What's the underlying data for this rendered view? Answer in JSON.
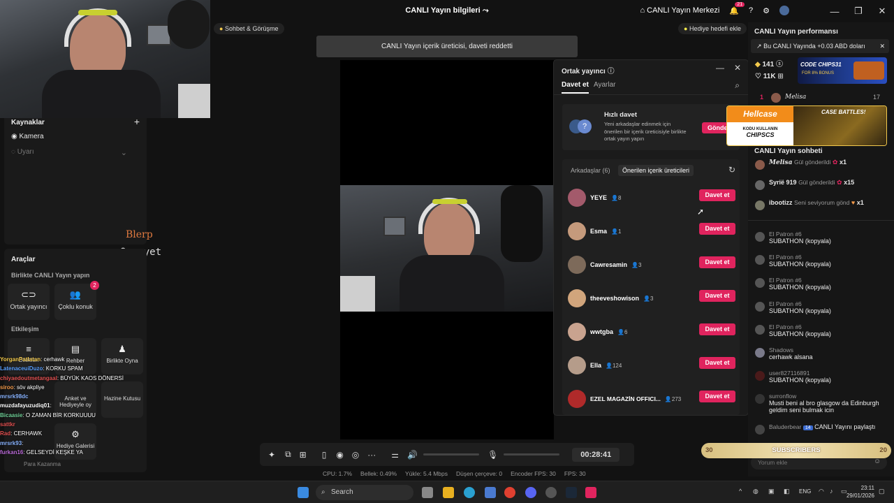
{
  "titlebar": {
    "title": "CANLI Yayın bilgileri",
    "live_center": "CANLI Yayın Merkezi",
    "notif_count": "21"
  },
  "left": {
    "sources_title": "Kaynaklar",
    "camera_label": "Kamera",
    "alerts_label": "Uyarı",
    "overlay_blerp": "Blerp",
    "overlay_overyet": "Overyet",
    "tools_title": "Araçlar",
    "together_title": "Birlikte CANLI Yayın yapın",
    "cohost_label": "Ortak yayıncı",
    "multiguest_label": "Çoklu konuk",
    "multiguest_badge": "2",
    "interaction_title": "Etkileşim",
    "tools": [
      "Dilekleri",
      "Rehber",
      "Birlikte Oyna",
      "Anket ve Hediyeyle oy",
      "Hazine Kutusu",
      "Hediye Galerisi",
      "Para Kazanma"
    ]
  },
  "overlay_chat": [
    {
      "user": "YorganPatlatan",
      "text": ": cerhawk"
    },
    {
      "user": "LatenaceuiDuzo",
      "text": ": KORKU SPAM"
    },
    {
      "user": "chiyaedoutmetangaal",
      "text": ": BÜYÜK KAOS DÖNERSİ"
    },
    {
      "user": "siroo",
      "text": ": söv akpliye"
    },
    {
      "user": "mrsrk98dc",
      "text": ""
    },
    {
      "user": "muzdafayuzudiq01",
      "text": ":"
    },
    {
      "user": "Bicaasie",
      "text": ": O ZAMAN BİR KORKUUUU"
    },
    {
      "user": "sattkr",
      "text": ""
    },
    {
      "user": "Rad",
      "text": ": CERHAWK"
    },
    {
      "user": "mrsrk93",
      "text": ":"
    },
    {
      "user": "furkan16",
      "text": ": GELSEYDİ KEŞKE YA"
    }
  ],
  "center": {
    "chat_pill": "Sohbet & Görüşme",
    "gift_goal": "Hediye hedefi ekle",
    "toast": "CANLI Yayın içerik üreticisi, daveti reddetti",
    "timer": "00:28:41",
    "stats": [
      "CPU: 1.7%",
      "Bellek: 0.49%",
      "Yükle: 5.4 Mbps",
      "Düşen çerçeve: 0",
      "Encoder FPS: 30",
      "FPS: 30"
    ]
  },
  "modal": {
    "title": "Ortak yayıncı",
    "tab_invite": "Davet et",
    "tab_settings": "Ayarlar",
    "quick_title": "Hızlı davet",
    "quick_desc": "Yeni arkadaşlar edinmek için önerilen bir içerik üreticisiyle birlikte ortak yayın yapın",
    "send_label": "Gönder",
    "friends_tab": "Arkadaşlar (6)",
    "suggested_tab": "Önerilen içerik üreticileri",
    "invite_label": "Davet et",
    "users": [
      {
        "name": "YEYE",
        "count": "8",
        "color": "#a35a6b"
      },
      {
        "name": "Esma",
        "count": "1",
        "color": "#c59a7c"
      },
      {
        "name": "Cawresamin",
        "count": "3",
        "color": "#7d6a5a"
      },
      {
        "name": "theeveshowison",
        "count": "3",
        "color": "#d1a57c"
      },
      {
        "name": "wwtgba",
        "count": "6",
        "color": "#c9a38f"
      },
      {
        "name": "Ella",
        "count": "124",
        "color": "#b59c8a"
      },
      {
        "name": "EZEL MAGAZİN OFFICI...",
        "count": "273",
        "color": "#b02a2a"
      }
    ]
  },
  "right": {
    "perf_title": "CANLI Yayın performansı",
    "earnings": "Bu CANLI Yayında +0.03 ABD doları",
    "diamonds": "141",
    "likes": "11K",
    "top_rank": "1",
    "top_user": "Melisa",
    "top_score": "17",
    "ad1_code": "CODE CHIPS31",
    "ad1_bonus": "FOR 8% BONUS",
    "ad2_brand": "Hellcase",
    "ad2_code": "KODU KULLANIN",
    "ad2_chips": "CHIPSCS",
    "ad2_battles": "CASE BATTLES!",
    "chat_title": "CANLI Yayın sohbeti",
    "gifts": [
      {
        "user": "Melisa",
        "action": "Gül gönderildi",
        "mult": "x1"
      },
      {
        "user": "Syrië 919",
        "action": "Gül gönderildi",
        "mult": "x15"
      },
      {
        "user": "ibootizz",
        "action": "Seni seviyorum gönd",
        "mult": "x1"
      }
    ],
    "messages": [
      {
        "name": "El Patron #6",
        "text": "SUBATHON (kopyala)"
      },
      {
        "name": "El Patron #6",
        "text": "SUBATHON (kopyala)"
      },
      {
        "name": "El Patron #6",
        "text": "SUBATHON (kopyala)"
      },
      {
        "name": "El Patron #6",
        "text": "SUBATHON (kopyala)"
      },
      {
        "name": "El Patron #6",
        "text": "SUBATHON (kopyala)"
      },
      {
        "name": "Shadows",
        "text": "cerhawk alsana"
      },
      {
        "name": "user827116891",
        "text": "SUBATHON (kopyala)"
      },
      {
        "name": "surronflow",
        "text": "Musti beni al bro glasgow da Edinburgh geldim seni bulmak icin"
      },
      {
        "name": "Baluderbear",
        "text": "CANLI Yayını paylaştı"
      }
    ],
    "badge_num": "14",
    "sub_left": "30",
    "sub_label": "SUBSCRIBERS",
    "sub_right": "20",
    "comment_placeholder": "Yorum ekle"
  },
  "taskbar": {
    "search": "Search",
    "lang": "ENG",
    "time": "23:11",
    "date": "29/01/2026"
  }
}
